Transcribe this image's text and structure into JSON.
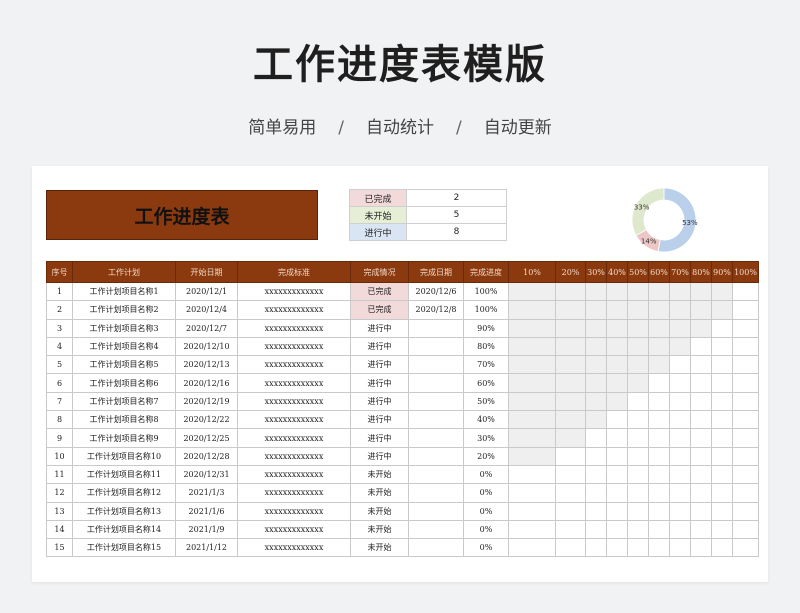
{
  "hero": {
    "title": "工作进度表模版",
    "tags": [
      "简单易用",
      "自动统计",
      "自动更新"
    ],
    "separator": "/"
  },
  "banner_title": "工作进度表",
  "summary": [
    {
      "label": "已完成",
      "value": "2"
    },
    {
      "label": "未开始",
      "value": "5"
    },
    {
      "label": "进行中",
      "value": "8"
    }
  ],
  "donut": {
    "slices": [
      {
        "label": "53%",
        "value": 53,
        "color": "#b9cfea"
      },
      {
        "label": "14%",
        "value": 14,
        "color": "#edc6c6"
      },
      {
        "label": "33%",
        "value": 33,
        "color": "#dde8cc"
      }
    ]
  },
  "table": {
    "headers": [
      "序号",
      "工作计划",
      "开始日期",
      "完成标准",
      "完成情况",
      "完成日期",
      "完成进度",
      "10%",
      "20%",
      "30%",
      "40%",
      "50%",
      "60%",
      "70%",
      "80%",
      "90%",
      "100%"
    ],
    "rows": [
      {
        "no": "1",
        "plan": "工作计划项目名称1",
        "start": "2020/12/1",
        "standard": "xxxxxxxxxxxxx",
        "status": "已完成",
        "done": "2020/12/6",
        "progress": "100%",
        "pct": 100
      },
      {
        "no": "2",
        "plan": "工作计划项目名称2",
        "start": "2020/12/4",
        "standard": "xxxxxxxxxxxxx",
        "status": "已完成",
        "done": "2020/12/8",
        "progress": "100%",
        "pct": 100
      },
      {
        "no": "3",
        "plan": "工作计划项目名称3",
        "start": "2020/12/7",
        "standard": "xxxxxxxxxxxxx",
        "status": "进行中",
        "done": "",
        "progress": "90%",
        "pct": 90
      },
      {
        "no": "4",
        "plan": "工作计划项目名称4",
        "start": "2020/12/10",
        "standard": "xxxxxxxxxxxxx",
        "status": "进行中",
        "done": "",
        "progress": "80%",
        "pct": 80
      },
      {
        "no": "5",
        "plan": "工作计划项目名称5",
        "start": "2020/12/13",
        "standard": "xxxxxxxxxxxxx",
        "status": "进行中",
        "done": "",
        "progress": "70%",
        "pct": 70
      },
      {
        "no": "6",
        "plan": "工作计划项目名称6",
        "start": "2020/12/16",
        "standard": "xxxxxxxxxxxxx",
        "status": "进行中",
        "done": "",
        "progress": "60%",
        "pct": 60
      },
      {
        "no": "7",
        "plan": "工作计划项目名称7",
        "start": "2020/12/19",
        "standard": "xxxxxxxxxxxxx",
        "status": "进行中",
        "done": "",
        "progress": "50%",
        "pct": 50
      },
      {
        "no": "8",
        "plan": "工作计划项目名称8",
        "start": "2020/12/22",
        "standard": "xxxxxxxxxxxxx",
        "status": "进行中",
        "done": "",
        "progress": "40%",
        "pct": 40
      },
      {
        "no": "9",
        "plan": "工作计划项目名称9",
        "start": "2020/12/25",
        "standard": "xxxxxxxxxxxxx",
        "status": "进行中",
        "done": "",
        "progress": "30%",
        "pct": 30
      },
      {
        "no": "10",
        "plan": "工作计划项目名称10",
        "start": "2020/12/28",
        "standard": "xxxxxxxxxxxxx",
        "status": "进行中",
        "done": "",
        "progress": "20%",
        "pct": 20
      },
      {
        "no": "11",
        "plan": "工作计划项目名称11",
        "start": "2020/12/31",
        "standard": "xxxxxxxxxxxxx",
        "status": "未开始",
        "done": "",
        "progress": "0%",
        "pct": 0
      },
      {
        "no": "12",
        "plan": "工作计划项目名称12",
        "start": "2021/1/3",
        "standard": "xxxxxxxxxxxxx",
        "status": "未开始",
        "done": "",
        "progress": "0%",
        "pct": 0
      },
      {
        "no": "13",
        "plan": "工作计划项目名称13",
        "start": "2021/1/6",
        "standard": "xxxxxxxxxxxxx",
        "status": "未开始",
        "done": "",
        "progress": "0%",
        "pct": 0
      },
      {
        "no": "14",
        "plan": "工作计划项目名称14",
        "start": "2021/1/9",
        "standard": "xxxxxxxxxxxxx",
        "status": "未开始",
        "done": "",
        "progress": "0%",
        "pct": 0
      },
      {
        "no": "15",
        "plan": "工作计划项目名称15",
        "start": "2021/1/12",
        "standard": "xxxxxxxxxxxxx",
        "status": "未开始",
        "done": "",
        "progress": "0%",
        "pct": 0
      }
    ]
  },
  "colors": {
    "header_brown": "#8b3a0f",
    "done_pink": "#f3dada",
    "todo_green": "#e6eed6",
    "prog_blue": "#d9e5f3",
    "bar_gray": "#efefef"
  }
}
